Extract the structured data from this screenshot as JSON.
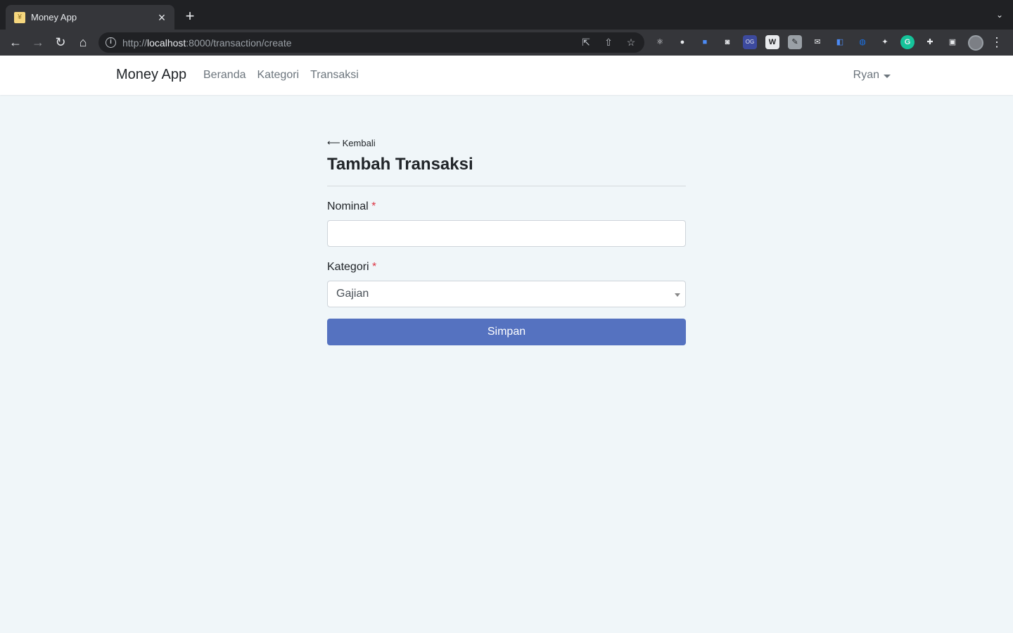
{
  "browser": {
    "tab_title": "Money App",
    "tab_close": "×",
    "new_tab": "+",
    "tab_search": "⌄",
    "url_scheme": "http://",
    "url_host": "localhost",
    "url_rest": ":8000/transaction/create",
    "back": "←",
    "forward": "→",
    "reload": "↻",
    "home": "⌂",
    "menu": "⋮"
  },
  "navbar": {
    "brand": "Money App",
    "links": [
      "Beranda",
      "Kategori",
      "Transaksi"
    ],
    "user": "Ryan"
  },
  "form": {
    "back_label": "Kembali",
    "back_arrow": "⟵",
    "title": "Tambah Transaksi",
    "nominal_label": "Nominal",
    "nominal_value": "",
    "category_label": "Kategori",
    "category_selected": "Gajian",
    "required_mark": "*",
    "submit_label": "Simpan"
  },
  "colors": {
    "page_bg": "#f0f6f9",
    "primary": "#5572c0",
    "required": "#dc3545"
  }
}
